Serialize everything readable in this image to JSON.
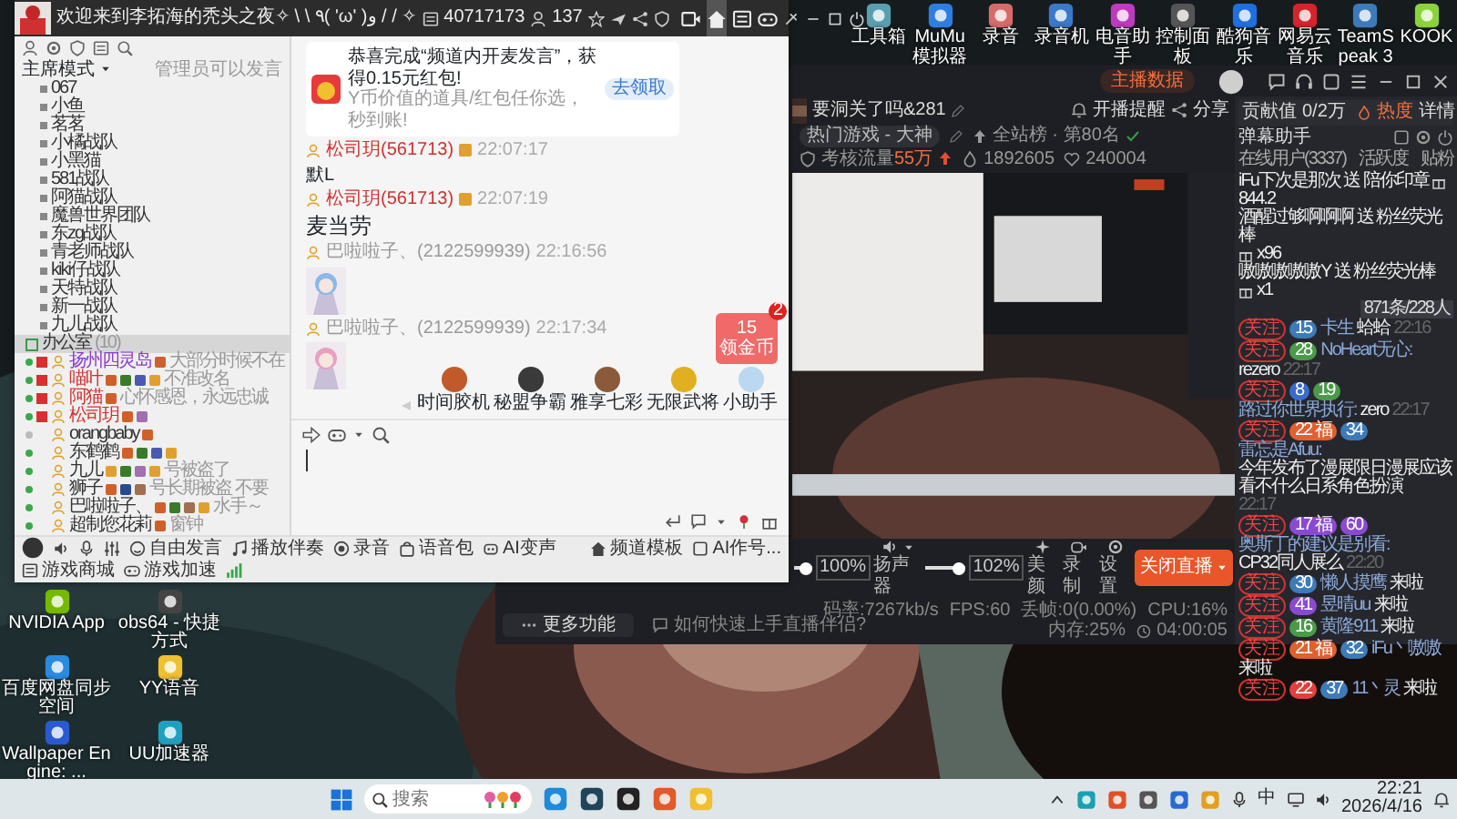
{
  "desktop_icons_top": [
    {
      "label": "工具箱",
      "color": "#5a9fb0"
    },
    {
      "label": "MuMu模拟器",
      "color": "#2f7de1"
    },
    {
      "label": "录音",
      "color": "#d86a6a"
    },
    {
      "label": "录音机",
      "color": "#3a78c8"
    },
    {
      "label": "电音助手",
      "color": "#c03ac0"
    },
    {
      "label": "控制面板",
      "color": "#555555"
    },
    {
      "label": "酷狗音乐",
      "color": "#1f6fe0"
    },
    {
      "label": "网易云音乐",
      "color": "#d4242c"
    },
    {
      "label": "TeamSpeak 3",
      "color": "#3d7ab8"
    },
    {
      "label": "KOOK",
      "color": "#8ad43a"
    }
  ],
  "desktop_icons_left": [
    {
      "label": "NVIDIA App",
      "color": "#76b900"
    },
    {
      "label": "obs64 - 快捷方式",
      "color": "#444444"
    },
    {
      "label": "百度网盘同步空间",
      "color": "#2a8ae0"
    },
    {
      "label": "YY语音",
      "color": "#f0c030"
    },
    {
      "label": "Wallpaper Engine: ...",
      "color": "#2a5ad0"
    },
    {
      "label": "UU加速器",
      "color": "#20a0c0"
    }
  ],
  "yy": {
    "title": "欢迎来到李拓海的秃头之夜✧ \\ \\ ٩( 'ω' )و / / ✧",
    "channel_id": "40717173",
    "online": "137",
    "nav": [
      {
        "kind": "video",
        "selected": false
      },
      {
        "kind": "home",
        "selected": true
      },
      {
        "kind": "list",
        "selected": false
      },
      {
        "kind": "game",
        "selected": false
      }
    ],
    "sidebar": {
      "mode": "主席模式",
      "note": "管理员可以发言",
      "channels": [
        {
          "name": "067"
        },
        {
          "name": "小鱼"
        },
        {
          "name": "茗茗"
        },
        {
          "name": "小橘战队"
        },
        {
          "name": "小黑猫"
        },
        {
          "name": "581战队"
        },
        {
          "name": "阿猫战队"
        },
        {
          "name": "魔兽世界团队"
        },
        {
          "name": "东zg战队"
        },
        {
          "name": "青老师战队"
        },
        {
          "name": "kiki仔战队"
        },
        {
          "name": "天特战队"
        },
        {
          "name": "新一战队"
        },
        {
          "name": "九儿战队"
        }
      ],
      "office": {
        "name": "办公室",
        "count": "(10)",
        "selected": true
      },
      "members": [
        {
          "name": "扬州四灵岛",
          "status": "大部分时候不在",
          "online": true,
          "muted": true,
          "color": "#8a3ad0",
          "medals": [
            {
              "color": "#d0602a"
            }
          ]
        },
        {
          "name": "喵叶",
          "status": "不准改名",
          "online": true,
          "muted": true,
          "color": "#d03030",
          "medals": [
            {
              "color": "#d0602a"
            },
            {
              "color": "#3a7a2a"
            },
            {
              "color": "#4a5ab0"
            },
            {
              "color": "#e0a030"
            }
          ]
        },
        {
          "name": "阿猫",
          "status": "心怀感恩，永远忠诚",
          "online": true,
          "muted": true,
          "color": "#d03030",
          "medals": [
            {
              "color": "#d0602a"
            }
          ]
        },
        {
          "name": "松司玥",
          "online": true,
          "muted": true,
          "color": "#d03030",
          "medals": [
            {
              "color": "#d0602a"
            },
            {
              "color": "#a070b0"
            }
          ]
        },
        {
          "name": "orangbaby",
          "online": false,
          "muted": false,
          "color": "#333333",
          "medals": [
            {
              "color": "#d0602a"
            }
          ]
        },
        {
          "name": "东鹤鹤",
          "online": true,
          "muted": false,
          "color": "#333333",
          "medals": [
            {
              "color": "#d0602a"
            },
            {
              "color": "#3a7a2a"
            },
            {
              "color": "#4a5ab0"
            },
            {
              "color": "#e0a030"
            }
          ]
        },
        {
          "name": "九儿",
          "status": "号被盗了",
          "online": true,
          "muted": false,
          "color": "#333333",
          "medals": [
            {
              "color": "#e0a030"
            },
            {
              "color": "#3a7a2a"
            },
            {
              "color": "#a070b0"
            },
            {
              "color": "#e0a030"
            }
          ]
        },
        {
          "name": "狮子",
          "status": "号长期被盗 不要",
          "online": true,
          "muted": false,
          "color": "#333333",
          "medals": [
            {
              "color": "#d0602a"
            },
            {
              "color": "#2a4a90"
            },
            {
              "color": "#a07050"
            }
          ]
        },
        {
          "name": "巴啦啦子、",
          "status": "水手～",
          "online": true,
          "muted": false,
          "color": "#333333",
          "medals": [
            {
              "color": "#d0602a"
            },
            {
              "color": "#3a7a2a"
            },
            {
              "color": "#a07050"
            },
            {
              "color": "#e0a030"
            }
          ]
        },
        {
          "name": "超制您花莉",
          "status": "窗钟",
          "online": true,
          "muted": false,
          "color": "#333333",
          "medals": [
            {
              "color": "#d0602a"
            }
          ]
        }
      ]
    },
    "promo": {
      "title": "恭喜完成“频道内开麦发言”，获得0.15元红包!",
      "subtitle": "Y币价值的道具/红包任你选，秒到账!",
      "button": "去领取"
    },
    "messages": [
      {
        "kind": "text",
        "user": "松司玥(561713)",
        "time": "22:07:17",
        "text": "默L",
        "large": false
      },
      {
        "kind": "text",
        "user": "松司玥(561713)",
        "time": "22:07:19",
        "text": "麦当劳",
        "large": true
      },
      {
        "user": "巴啦啦子、(2122599939)",
        "time": "22:16:56"
      },
      {
        "user": "巴啦啦子、(2122599939)",
        "time": "22:17:34"
      }
    ],
    "coin_tile": {
      "amount": "15",
      "label": "领金币",
      "badge": "2"
    },
    "gift_avatars": [
      {
        "label": "时间胶机",
        "color": "#c05a2a"
      },
      {
        "label": "秘盟争霸",
        "color": "#3a3a3a"
      },
      {
        "label": "雅享七彩",
        "color": "#8a5a3a"
      },
      {
        "label": "无限武将",
        "color": "#e0b020"
      },
      {
        "label": "小助手",
        "color": "#bcd8f0"
      }
    ],
    "toolbar_left": [
      "自由发言",
      "播放伴奏",
      "录音",
      "语音包",
      "AI变声"
    ],
    "toolbar_right": [
      "频道模板",
      "AI作号...",
      "游戏商城",
      "游戏加速"
    ]
  },
  "stream": {
    "data_button": "主播数据",
    "title": "要洞关了吗&281",
    "remind": "开播提醒",
    "share": "分享",
    "category": "热门游戏 - 大神",
    "rank": "全站榜 · 第80名",
    "assessment": "考核流量",
    "assessment_value": "55万",
    "heat": "1892605",
    "likes": "240004",
    "mic": {
      "level": 1,
      "reading": "100%"
    },
    "speaker": {
      "label": "扬声器",
      "level": 1,
      "reading": "102%"
    },
    "tools": [
      {
        "kind": "beauty",
        "label": "美颜"
      },
      {
        "kind": "record",
        "label": "录制"
      },
      {
        "kind": "settings",
        "label": "设置"
      }
    ],
    "end_button": "关闭直播",
    "more": "更多功能",
    "help": "如何快速上手直播伴侣?",
    "stats": [
      "码率:7267kb/s",
      "FPS:60",
      "丢帧:0(0.00%)",
      "CPU:16%",
      "内存:25%"
    ],
    "timer": "04:00:05",
    "panel": {
      "contribution_label": "贡献值",
      "contribution": "0/2万",
      "heat_label": "热度",
      "details": "详情",
      "assistant": "弹幕助手",
      "tabs": [
        "在线用户(3337)",
        "活跃度",
        "贴粉"
      ],
      "counter": "871条/228人",
      "feed": [
        {
          "kind": "gift",
          "text": "iFu下次是那次 送 陪你印章",
          "amount": "844.2"
        },
        {
          "kind": "gift",
          "text": "酒醒过够啊啊啊 送 粉丝荧光棒",
          "amount": "x96"
        },
        {
          "kind": "gift",
          "text": "嗷嗷嗷嗷嗷Y 送 粉丝荧光棒",
          "amount": "x1"
        },
        {
          "kind": "message",
          "follow": "关注",
          "fan": {
            "text": "15",
            "color": "#3d7ab8"
          },
          "name": "卡生",
          "text": "蛤蛤",
          "time": "22:16"
        },
        {
          "kind": "message",
          "follow": "关注",
          "fan": {
            "text": "28",
            "color": "#4a9a4a"
          },
          "name": "NoHeart无心:",
          "text": "rezero",
          "time": "22:17"
        },
        {
          "kind": "message",
          "follow": "关注",
          "club": {
            "text": "8",
            "color": "#3a6ad0"
          },
          "fan": {
            "text": "19",
            "color": "#4a9a4a"
          },
          "name": "路过你世界执行:",
          "text": "zero",
          "time": "22:17"
        },
        {
          "kind": "message",
          "follow": "关注",
          "club": {
            "text": "22 福",
            "color": "#e06030"
          },
          "fan": {
            "text": "34",
            "color": "#3d7ab8"
          },
          "name": "雷忘是Afuu:",
          "text": "今年发布了漫展限日漫展应该看不什么日系角色扮演",
          "time": "22:17"
        },
        {
          "kind": "message",
          "follow": "关注",
          "club": {
            "text": "17 福",
            "color": "#8a4ad0"
          },
          "fan": {
            "text": "60",
            "color": "#8a4ad0"
          },
          "name": "奥斯丁的建议是别看:",
          "text": "CP32同人展么",
          "time": "22:20"
        },
        {
          "kind": "message",
          "follow": "关注",
          "fan": {
            "text": "30",
            "color": "#3d7ab8"
          },
          "name": "懒人摸鹰",
          "text": "来啦"
        },
        {
          "kind": "message",
          "follow": "关注",
          "fan": {
            "text": "41",
            "color": "#8a4ad0"
          },
          "name": "昱晴uu",
          "text": "来啦"
        },
        {
          "kind": "message",
          "follow": "关注",
          "fan": {
            "text": "16",
            "color": "#4a9a4a"
          },
          "name": "黄隆911",
          "text": "来啦"
        },
        {
          "kind": "message",
          "follow": "关注",
          "club": {
            "text": "21 福",
            "color": "#e06030"
          },
          "fan": {
            "text": "32",
            "color": "#3d7ab8"
          },
          "name": "iFu丶嗷嗷",
          "text": "来啦"
        },
        {
          "kind": "message",
          "follow": "关注",
          "club": {
            "text": "22",
            "color": "#e04040"
          },
          "fan": {
            "text": "37",
            "color": "#3d7ab8"
          },
          "name": "11丶灵",
          "text": "来啦"
        }
      ]
    }
  },
  "taskbar": {
    "search": {
      "placeholder": "搜索"
    },
    "ime": "中",
    "time": "22:21",
    "date": "2026/4/16"
  }
}
